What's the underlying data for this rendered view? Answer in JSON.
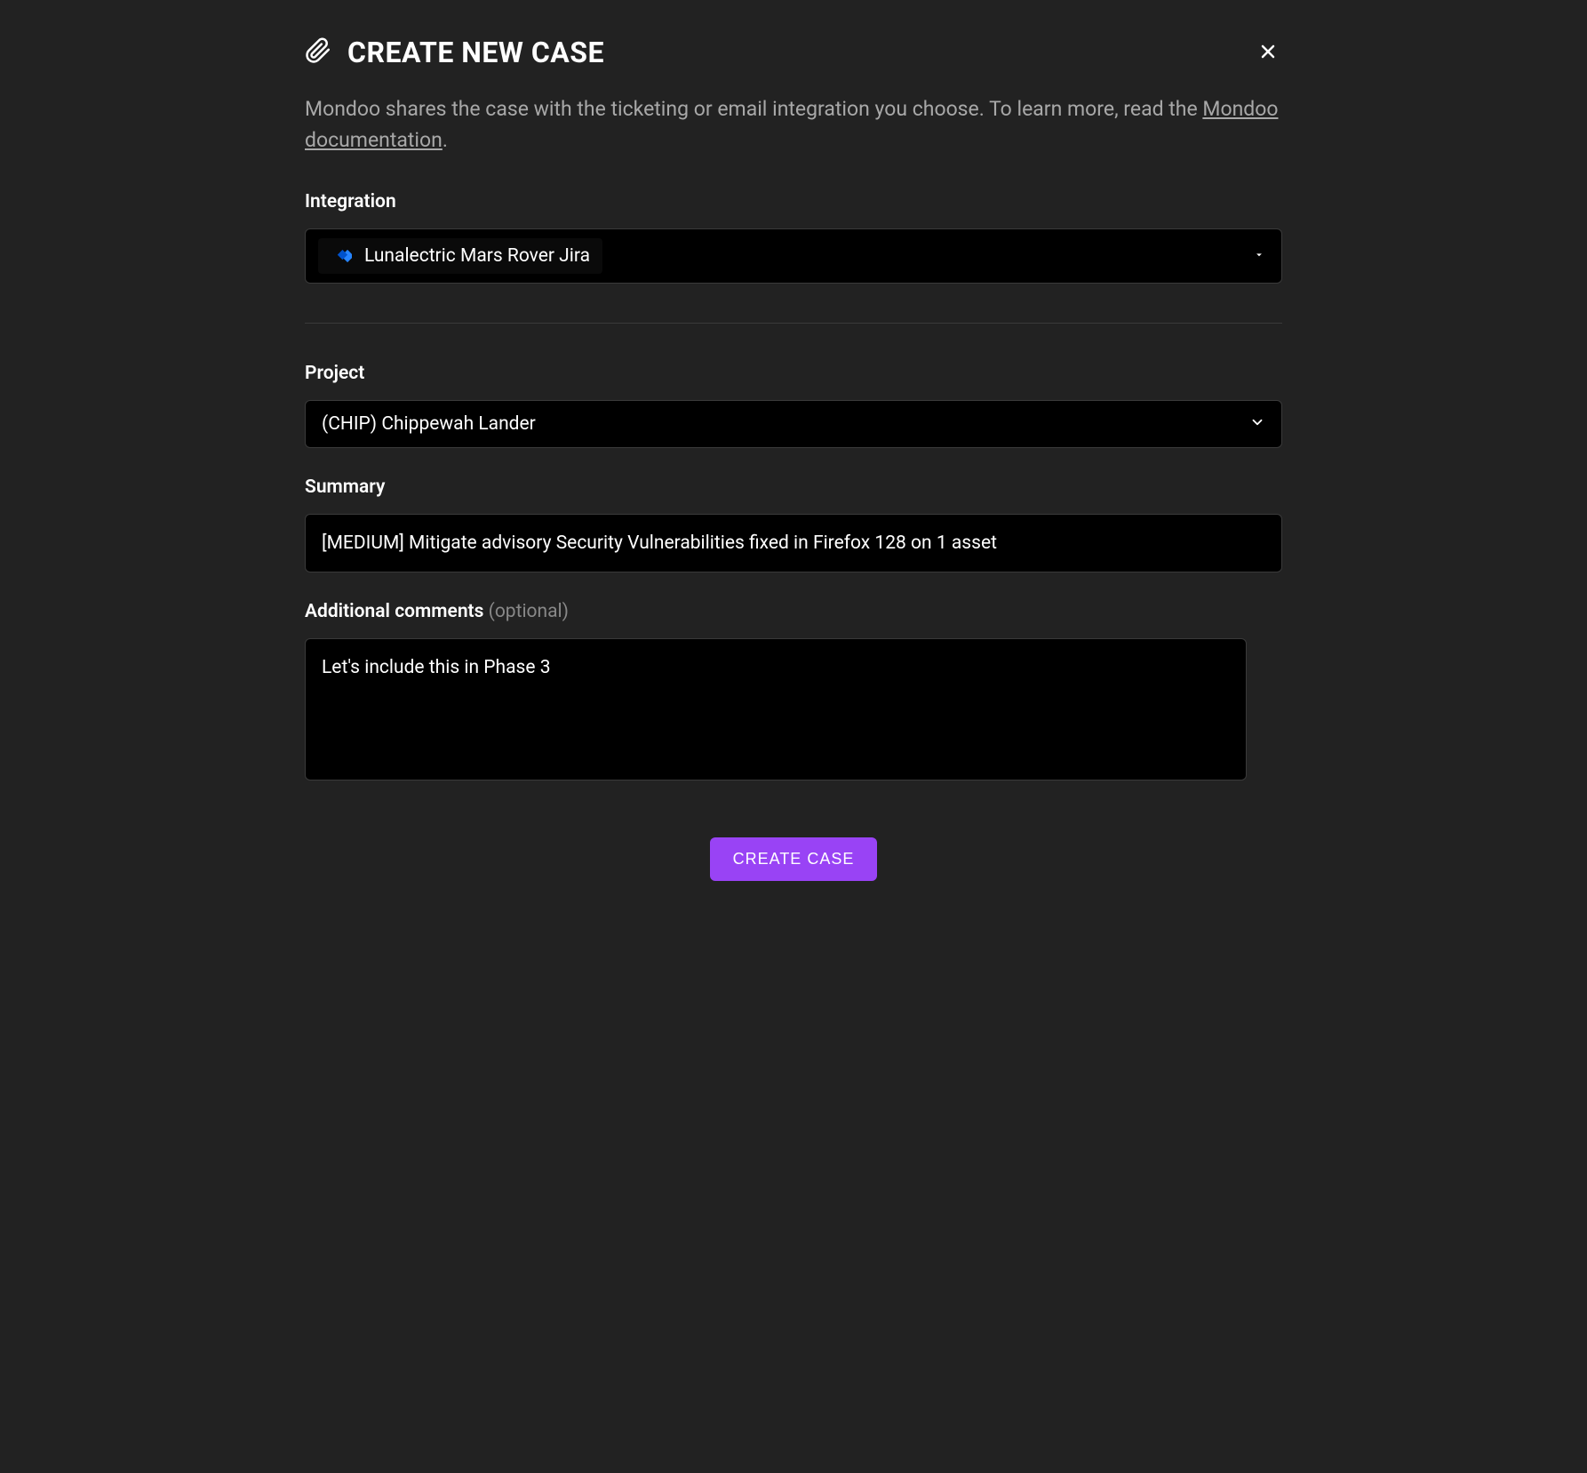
{
  "modal": {
    "title": "CREATE NEW CASE",
    "description_prefix": "Mondoo shares the case with the ticketing or email integration you choose. To learn more, read the ",
    "description_link": "Mondoo documentation",
    "description_suffix": "."
  },
  "form": {
    "integration": {
      "label": "Integration",
      "selected": "Lunalectric Mars Rover Jira"
    },
    "project": {
      "label": "Project",
      "selected": "(CHIP) Chippewah Lander"
    },
    "summary": {
      "label": "Summary",
      "value": "[MEDIUM] Mitigate advisory Security Vulnerabilities fixed in Firefox 128 on 1 asset"
    },
    "comments": {
      "label": "Additional comments ",
      "optional": "(optional)",
      "value": "Let's include this in Phase 3"
    }
  },
  "buttons": {
    "create": "CREATE CASE"
  }
}
